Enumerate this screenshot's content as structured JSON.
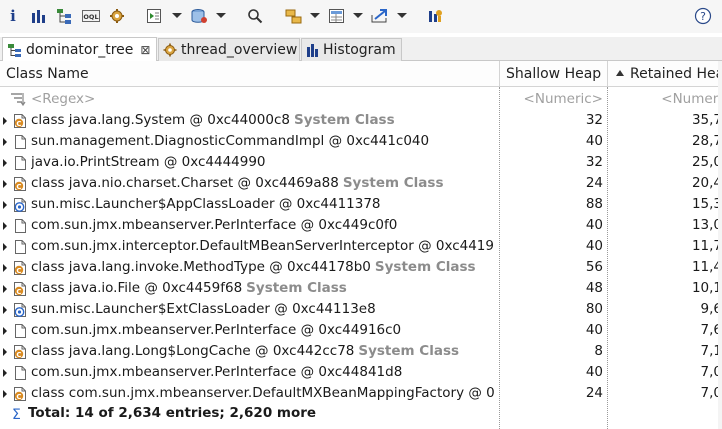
{
  "toolbar": {
    "buttons": [
      {
        "icon": "info-icon"
      },
      {
        "icon": "histogram-icon"
      },
      {
        "icon": "dominator-tree-icon"
      },
      {
        "icon": "oql-icon"
      },
      {
        "icon": "heap-dump-overview-icon"
      },
      {
        "icon": "run-report-icon"
      },
      {
        "icon": "query-browser-icon"
      },
      {
        "icon": "search-icon"
      },
      {
        "icon": "group-by-icon"
      },
      {
        "icon": "calculate-retained-icon"
      },
      {
        "icon": "export-icon"
      },
      {
        "icon": "leak-suspects-icon"
      },
      {
        "icon": "help-icon"
      }
    ],
    "help_label": "?",
    "info_label": "i",
    "oql_label": "OQL"
  },
  "tabs": [
    {
      "label": "dominator_tree",
      "icon": "dominator-tree-icon",
      "active": true,
      "close": "⊠"
    },
    {
      "label": "thread_overview",
      "icon": "gear-icon",
      "active": false
    },
    {
      "label": "Histogram",
      "icon": "histogram-icon",
      "active": false
    }
  ],
  "table": {
    "columns": {
      "class_name": "Class Name",
      "shallow_heap": "Shallow Heap",
      "retained_heap": "Retained Hea"
    },
    "filter": {
      "name": "<Regex>",
      "shallow": "<Numeric>",
      "retained": "<Numeri"
    },
    "rows": [
      {
        "name": "class java.lang.System @ 0xc44000c8",
        "system_tag": "System Class",
        "icon": "class-object-icon",
        "shallow": "32",
        "retained": "35,7"
      },
      {
        "name": "sun.management.DiagnosticCommandImpl @ 0xc441c040",
        "system_tag": "",
        "icon": "object-icon",
        "shallow": "40",
        "retained": "28,7"
      },
      {
        "name": "java.io.PrintStream @ 0xc4444990",
        "system_tag": "",
        "icon": "object-icon",
        "shallow": "32",
        "retained": "25,0"
      },
      {
        "name": "class java.nio.charset.Charset @ 0xc4469a88",
        "system_tag": "System Class",
        "icon": "class-object-icon",
        "shallow": "24",
        "retained": "20,4"
      },
      {
        "name": "sun.misc.Launcher$AppClassLoader @ 0xc4411378",
        "system_tag": "",
        "icon": "classloader-icon",
        "shallow": "88",
        "retained": "15,3"
      },
      {
        "name": "com.sun.jmx.mbeanserver.PerInterface @ 0xc449c0f0",
        "system_tag": "",
        "icon": "object-icon",
        "shallow": "40",
        "retained": "13,0"
      },
      {
        "name": "com.sun.jmx.interceptor.DefaultMBeanServerInterceptor @ 0xc4419",
        "system_tag": "",
        "icon": "object-icon",
        "shallow": "40",
        "retained": "11,7"
      },
      {
        "name": "class java.lang.invoke.MethodType @ 0xc44178b0",
        "system_tag": "System Class",
        "icon": "class-object-icon",
        "shallow": "56",
        "retained": "11,4"
      },
      {
        "name": "class java.io.File @ 0xc4459f68",
        "system_tag": "System Class",
        "icon": "class-object-icon",
        "shallow": "48",
        "retained": "10,1"
      },
      {
        "name": "sun.misc.Launcher$ExtClassLoader @ 0xc44113e8",
        "system_tag": "",
        "icon": "classloader-icon",
        "shallow": "80",
        "retained": "9,6"
      },
      {
        "name": "com.sun.jmx.mbeanserver.PerInterface @ 0xc44916c0",
        "system_tag": "",
        "icon": "object-icon",
        "shallow": "40",
        "retained": "7,6"
      },
      {
        "name": "class java.lang.Long$LongCache @ 0xc442cc78",
        "system_tag": "System Class",
        "icon": "class-object-icon",
        "shallow": "8",
        "retained": "7,1"
      },
      {
        "name": "com.sun.jmx.mbeanserver.PerInterface @ 0xc44841d8",
        "system_tag": "",
        "icon": "object-icon",
        "shallow": "40",
        "retained": "7,0"
      },
      {
        "name": "class com.sun.jmx.mbeanserver.DefaultMXBeanMappingFactory @ 0",
        "system_tag": "",
        "icon": "class-object-icon",
        "shallow": "24",
        "retained": "7,0"
      }
    ],
    "total": "Total: 14 of 2,634 entries; 2,620 more",
    "total_icon": "sum-icon",
    "sort": "retained-heap-ascending-indicator"
  },
  "colors": {
    "system_tag": "#8c8c8c",
    "filter_text": "#a0a0a0",
    "accent": "#2b66c8"
  }
}
